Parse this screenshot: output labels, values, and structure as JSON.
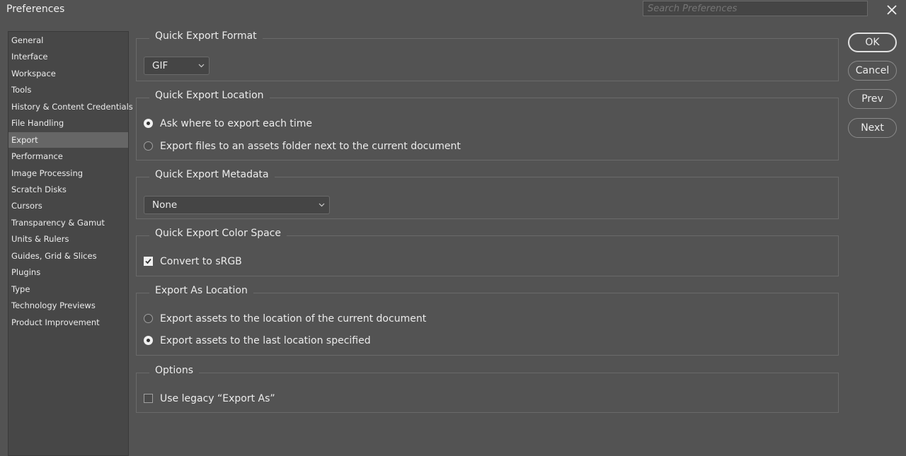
{
  "window": {
    "title": "Preferences",
    "search_placeholder": "Search Preferences",
    "close_icon": "close-icon"
  },
  "sidebar": {
    "items": [
      {
        "label": "General"
      },
      {
        "label": "Interface"
      },
      {
        "label": "Workspace"
      },
      {
        "label": "Tools"
      },
      {
        "label": "History & Content Credentials"
      },
      {
        "label": "File Handling"
      },
      {
        "label": "Export",
        "selected": true
      },
      {
        "label": "Performance"
      },
      {
        "label": "Image Processing"
      },
      {
        "label": "Scratch Disks"
      },
      {
        "label": "Cursors"
      },
      {
        "label": "Transparency & Gamut"
      },
      {
        "label": "Units & Rulers"
      },
      {
        "label": "Guides, Grid & Slices"
      },
      {
        "label": "Plugins"
      },
      {
        "label": "Type"
      },
      {
        "label": "Technology Previews"
      },
      {
        "label": "Product Improvement"
      }
    ]
  },
  "sections": {
    "quick_export_format": {
      "title": "Quick Export Format",
      "format_value": "GIF"
    },
    "quick_export_location": {
      "title": "Quick Export Location",
      "options": [
        {
          "label": "Ask where to export each time",
          "checked": true
        },
        {
          "label": "Export files to an assets folder next to the current document",
          "checked": false
        }
      ]
    },
    "quick_export_metadata": {
      "title": "Quick Export Metadata",
      "metadata_value": "None"
    },
    "quick_export_color_space": {
      "title": "Quick Export Color Space",
      "convert_label": "Convert to sRGB",
      "convert_checked": true
    },
    "export_as_location": {
      "title": "Export As Location",
      "options": [
        {
          "label": "Export assets to the location of the current document",
          "checked": false
        },
        {
          "label": "Export assets to the last location specified",
          "checked": true
        }
      ]
    },
    "options": {
      "title": "Options",
      "legacy_label": "Use legacy “Export As”",
      "legacy_checked": false
    }
  },
  "buttons": {
    "ok": "OK",
    "cancel": "Cancel",
    "prev": "Prev",
    "next": "Next"
  },
  "colors": {
    "background": "#535353",
    "sidebar_bg": "#474747",
    "selected_item_bg": "#666666",
    "text": "#ececec"
  }
}
